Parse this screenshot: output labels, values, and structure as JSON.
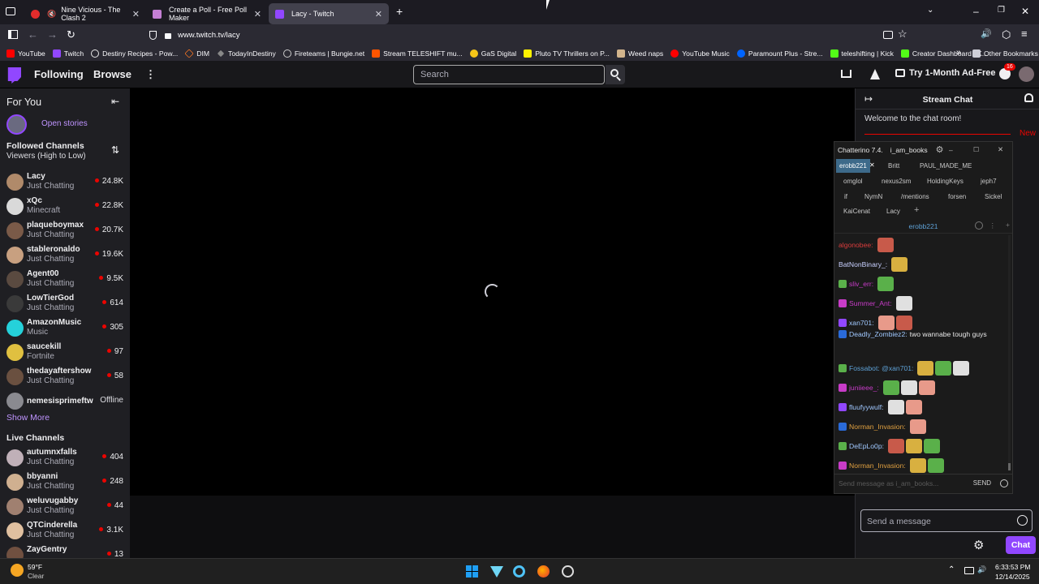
{
  "browser": {
    "tabs": [
      {
        "label": "Nine Vicious - The Clash 2",
        "color": "#e22c2c"
      },
      {
        "label": "Create a Poll - Free Poll Maker",
        "color": "#c47fd4"
      },
      {
        "label": "Lacy - Twitch",
        "color": "#9147ff"
      }
    ],
    "url": "www.twitch.tv/lacy",
    "bookmarks": [
      {
        "label": "YouTube",
        "color": "#ff0000"
      },
      {
        "label": "Twitch",
        "color": "#9147ff"
      },
      {
        "label": "Destiny Recipes - Pow...",
        "color": "#e8e8e8"
      },
      {
        "label": "DIM",
        "color": "#f37423"
      },
      {
        "label": "TodayInDestiny",
        "color": "#888888"
      },
      {
        "label": "Fireteams | Bungie.net",
        "color": "#cccccc"
      },
      {
        "label": "Stream TELESHIFT mu...",
        "color": "#ff5500"
      },
      {
        "label": "GaS Digital",
        "color": "#f5c518"
      },
      {
        "label": "Pluto TV Thrillers on P...",
        "color": "#fff200"
      },
      {
        "label": "Weed naps",
        "color": "#d2b48c"
      },
      {
        "label": "YouTube Music",
        "color": "#ff0000"
      },
      {
        "label": "Paramount Plus - Stre...",
        "color": "#0064ff"
      },
      {
        "label": "teleshifting | Kick",
        "color": "#53fc18"
      },
      {
        "label": "Creator Dashboard | K...",
        "color": "#53fc18"
      }
    ],
    "other_bookmarks": "Other Bookmarks"
  },
  "twitch": {
    "nav": {
      "following": "Following",
      "browse": "Browse",
      "search_placeholder": "Search",
      "ad_free": "Try 1-Month Ad-Free",
      "notif_count": "16"
    },
    "sidebar": {
      "for_you": "For You",
      "open_stories": "Open stories",
      "followed_title": "Followed Channels",
      "sort": "Viewers (High to Low)",
      "followed": [
        {
          "name": "Lacy",
          "game": "Just Chatting",
          "viewers": "24.8K",
          "color": "#b08a6a"
        },
        {
          "name": "xQc",
          "game": "Minecraft",
          "viewers": "22.8K",
          "color": "#d9d9d9"
        },
        {
          "name": "plaqueboymax",
          "game": "Just Chatting",
          "viewers": "20.7K",
          "color": "#7a5a48"
        },
        {
          "name": "stableronaldo",
          "game": "Just Chatting",
          "viewers": "19.6K",
          "color": "#c8a080"
        },
        {
          "name": "Agent00",
          "game": "Just Chatting",
          "viewers": "9.5K",
          "color": "#5a4a40"
        },
        {
          "name": "LowTierGod",
          "game": "Just Chatting",
          "viewers": "614",
          "color": "#3a3a3a"
        },
        {
          "name": "AmazonMusic",
          "game": "Music",
          "viewers": "305",
          "color": "#25d1da"
        },
        {
          "name": "saucekill",
          "game": "Fortnite",
          "viewers": "97",
          "color": "#e0c040"
        },
        {
          "name": "thedayaftershow",
          "game": "Just Chatting",
          "viewers": "58",
          "color": "#6a5040"
        },
        {
          "name": "nemesisprimeftw",
          "game": "",
          "viewers": "Offline",
          "color": "#8a8a90"
        }
      ],
      "show_more": "Show More",
      "live_title": "Live Channels",
      "live": [
        {
          "name": "autumnxfalls",
          "game": "Just Chatting",
          "viewers": "404",
          "color": "#c0b0b8"
        },
        {
          "name": "bbyanni",
          "game": "Just Chatting",
          "viewers": "248",
          "color": "#d0b090"
        },
        {
          "name": "weluvugabby",
          "game": "Just Chatting",
          "viewers": "44",
          "color": "#a08070"
        },
        {
          "name": "QTCinderella",
          "game": "Just Chatting",
          "viewers": "3.1K",
          "color": "#e0c0a0"
        },
        {
          "name": "ZayGentry",
          "game": "",
          "viewers": "13",
          "color": "#705040"
        }
      ]
    },
    "chat": {
      "title": "Stream Chat",
      "welcome": "Welcome to the chat room!",
      "new": "New",
      "placeholder": "Send a message",
      "button": "Chat"
    }
  },
  "chatterino": {
    "title": "Chatterino 7.4.",
    "user": "i_am_books",
    "tabs_row1": [
      "erobb221",
      "Britt",
      "PAUL_MADE_ME"
    ],
    "tabs_row2": [
      "omglol",
      "nexus2sm",
      "HoldingKeys",
      "jeph7"
    ],
    "tabs_row3": [
      "if",
      "NymN",
      "/mentions",
      "forsen",
      "Sickel"
    ],
    "tabs_row4": [
      "KaiCenat",
      "Lacy"
    ],
    "channel": "erobb221",
    "messages": [
      {
        "user": "algonobee:",
        "text": "",
        "color": "#d83c3c"
      },
      {
        "user": "BatNonBinary_:",
        "text": "",
        "color": "#c8d0ff"
      },
      {
        "user": "sliv_err:",
        "text": "",
        "color": "#c83cc8"
      },
      {
        "user": "Summer_Ant:",
        "text": "",
        "color": "#c83cc8"
      },
      {
        "user": "xan701:",
        "text": "",
        "color": "#a0c8ff"
      },
      {
        "user": "Deadly_Zombiez2:",
        "text": "two wannabe tough guys",
        "color": "#a0c8ff"
      },
      {
        "user": "Fossabot: @xan701:",
        "text": "",
        "color": "#5ea1d6"
      },
      {
        "user": "juniieee_:",
        "text": "",
        "color": "#c83cc8"
      },
      {
        "user": "fluufyywulf:",
        "text": "",
        "color": "#a0c8ff"
      },
      {
        "user": "Norman_Invasion:",
        "text": "",
        "color": "#e0a040"
      },
      {
        "user": "DeEpLo0p:",
        "text": "",
        "color": "#a0c8ff"
      },
      {
        "user": "Norman_Invasion:",
        "text": "",
        "color": "#e0a040"
      }
    ],
    "input_placeholder": "Send message as i_am_books...",
    "send": "SEND"
  },
  "taskbar": {
    "temp": "59°F",
    "weather": "Clear",
    "time": "6:33:53 PM",
    "date": "12/14/2025"
  }
}
